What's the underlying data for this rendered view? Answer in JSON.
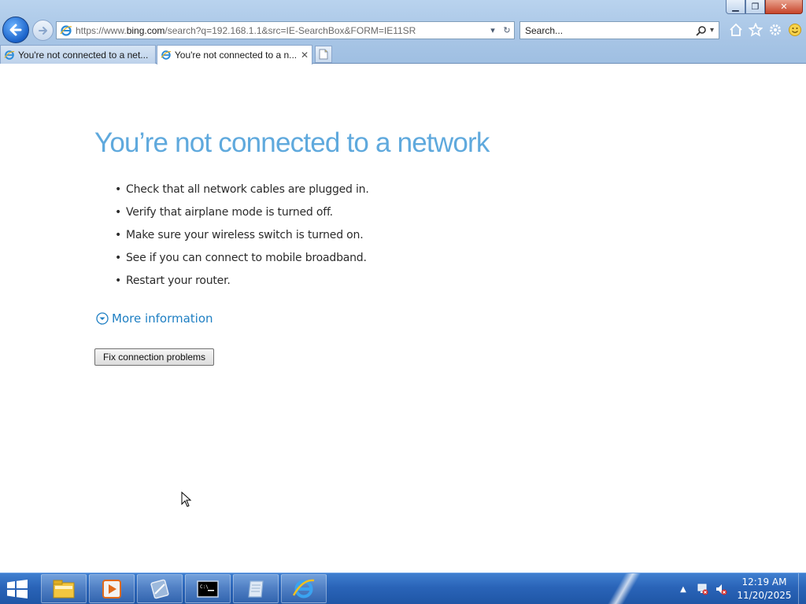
{
  "window": {
    "minimize_icon": "minimize-icon",
    "restore_icon": "restore-icon",
    "close_icon": "close-icon"
  },
  "navigation": {
    "back_icon": "back-arrow-icon",
    "forward_icon": "forward-arrow-icon"
  },
  "address_bar": {
    "url_prefix": "https://www.",
    "url_domain": "bing.com",
    "url_rest": "/search?q=192.168.1.1&src=IE-SearchBox&FORM=IE11SR"
  },
  "search_box": {
    "placeholder": "Search..."
  },
  "tabs": [
    {
      "label": "You're not connected to a net...",
      "active": false
    },
    {
      "label": "You're not connected to a n...",
      "active": true
    }
  ],
  "page": {
    "heading": "You’re not connected to a network",
    "bullets": [
      "Check that all network cables are plugged in.",
      "Verify that airplane mode is turned off.",
      "Make sure your wireless switch is turned on.",
      "See if you can connect to mobile broadband.",
      "Restart your router."
    ],
    "more_info": "More information",
    "fix_button": "Fix connection problems"
  },
  "taskbar": {
    "pinned": [
      "file-explorer-icon",
      "media-player-icon",
      "server-manager-icon",
      "command-prompt-icon",
      "notepad-icon",
      "internet-explorer-icon"
    ],
    "clock_time": "12:19 AM",
    "clock_date": "11/20/2025"
  },
  "colors": {
    "heading": "#5fa9dd",
    "link": "#1e7fc3",
    "taskbar": "#2a64b8"
  }
}
